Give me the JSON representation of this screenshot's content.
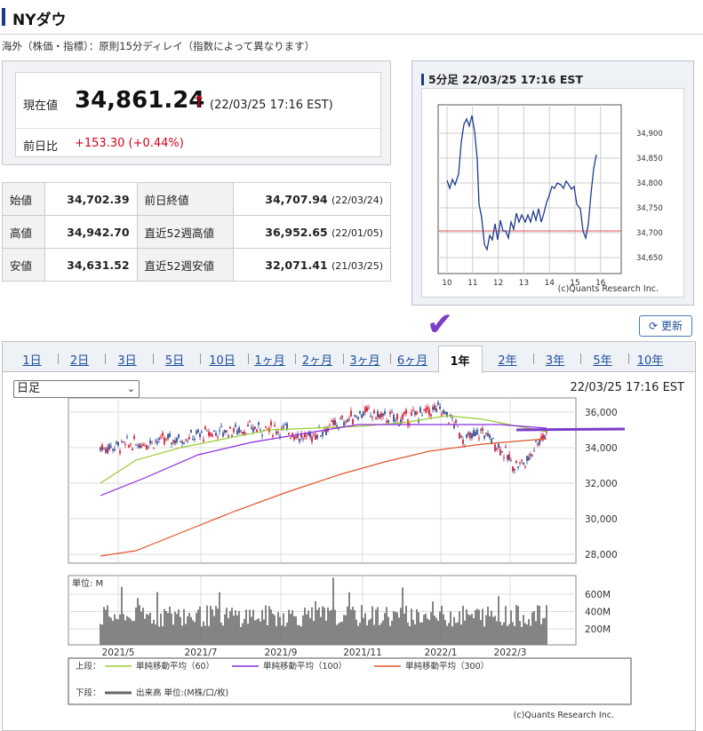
{
  "header": {
    "title": "NYダウ",
    "note": "海外（株価・指標）：原則15分ディレイ（指数によって異なります）"
  },
  "price": {
    "label": "現在値",
    "value": "34,861.24",
    "arrow": "↑",
    "timestamp": "(22/03/25 17:16 EST)",
    "change_label": "前日比",
    "change": "+153.30 (+0.44%)"
  },
  "stats": [
    {
      "l1": "始値",
      "v1": "34,702.39",
      "l2": "前日終値",
      "v2": "34,707.94",
      "d2": "(22/03/24)"
    },
    {
      "l1": "高値",
      "v1": "34,942.70",
      "l2": "直近52週高値",
      "v2": "36,952.65",
      "d2": "(22/01/05)"
    },
    {
      "l1": "安値",
      "v1": "34,631.52",
      "l2": "直近52週安値",
      "v2": "32,071.41",
      "d2": "(21/03/25)"
    }
  ],
  "mini": {
    "title": "5分足 22/03/25 17:16 EST",
    "y_ticks": [
      "34,900",
      "34,850",
      "34,800",
      "34,750",
      "34,700",
      "34,650"
    ],
    "x_ticks": [
      "10",
      "11",
      "12",
      "13",
      "14",
      "15",
      "16"
    ],
    "credit": "(c)Quants Research Inc.",
    "ref_color": "#e05050",
    "line_color": "#1e3a8c"
  },
  "refresh_label": "更新",
  "tabs": [
    "1日",
    "2日",
    "3日",
    "5日",
    "10日",
    "1ヶ月",
    "2ヶ月",
    "3ヶ月",
    "6ヶ月",
    "1年",
    "2年",
    "3年",
    "5年",
    "10年"
  ],
  "selected_tab": "1年",
  "period_select": "日足",
  "chart_datetime": "22/03/25 17:16 EST",
  "chart_data": {
    "type": "line",
    "y_ticks": [
      "36,000",
      "34,000",
      "32,000",
      "30,000",
      "28,000"
    ],
    "ylim": [
      27500,
      36800
    ],
    "x_ticks": [
      "2021/5",
      "2021/7",
      "2021/9",
      "2021/11",
      "2022/1",
      "2022/3"
    ],
    "volume_label": "単位: M",
    "volume_ticks": [
      "600M",
      "400M",
      "200M"
    ],
    "series": [
      {
        "name": "単純移動平均（60）",
        "color": "#9acd32"
      },
      {
        "name": "単純移動平均（100）",
        "color": "#8a2be2"
      },
      {
        "name": "単純移動平均（300）",
        "color": "#e0552a"
      }
    ],
    "legend_upper": "上段：",
    "legend_lower": "下段：",
    "volume_series": "出来高 単位:(M株/口/枚)"
  },
  "credit": "(c)Quants Research Inc."
}
